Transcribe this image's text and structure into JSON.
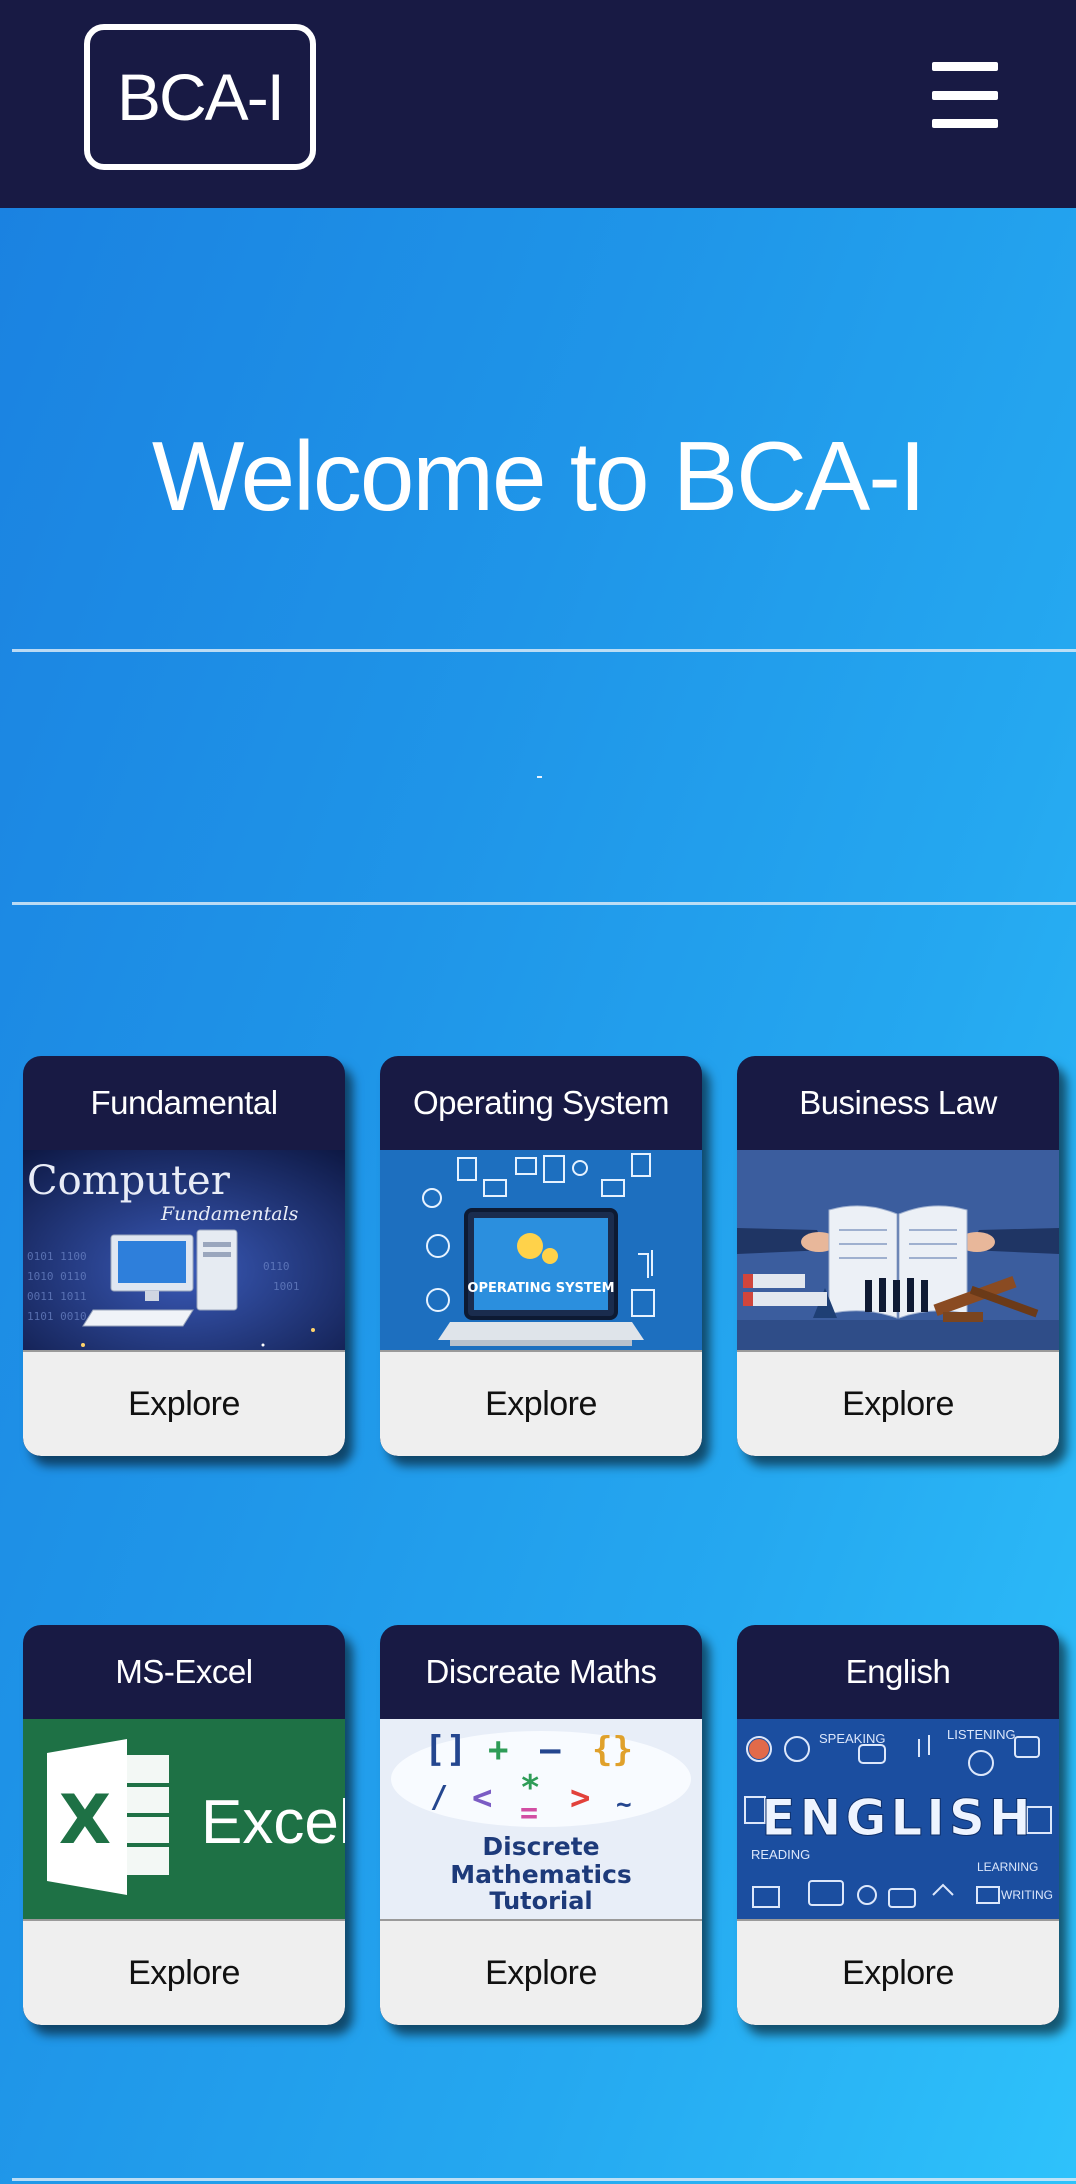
{
  "navbar": {
    "brand": "BCA-I",
    "menu_icon": "hamburger-menu-icon"
  },
  "hero": {
    "title": "Welcome to BCA-I"
  },
  "cards": [
    {
      "title": "Fundamental",
      "image_text": "Computer",
      "image_subtext": "Fundamentals",
      "button": "Explore"
    },
    {
      "title": "Operating System",
      "image_text": "OPERATING SYSTEM",
      "button": "Explore"
    },
    {
      "title": "Business Law",
      "button": "Explore"
    },
    {
      "title": "MS-Excel",
      "image_text": "Excel",
      "image_letter": "X",
      "button": "Explore"
    },
    {
      "title": "Discreate Maths",
      "image_line1": "Discrete",
      "image_line2": "Mathematics",
      "image_line3": "Tutorial",
      "button": "Explore"
    },
    {
      "title": "English",
      "image_text": "ENGLISH",
      "image_words": [
        "SPEAKING",
        "LISTENING",
        "READING",
        "LEARNING",
        "WRITING"
      ],
      "button": "Explore"
    }
  ],
  "colors": {
    "navbar": "#181a44",
    "accent_blue": "#1f95e8",
    "excel_green": "#1e7145",
    "button_bg": "#efefef"
  }
}
